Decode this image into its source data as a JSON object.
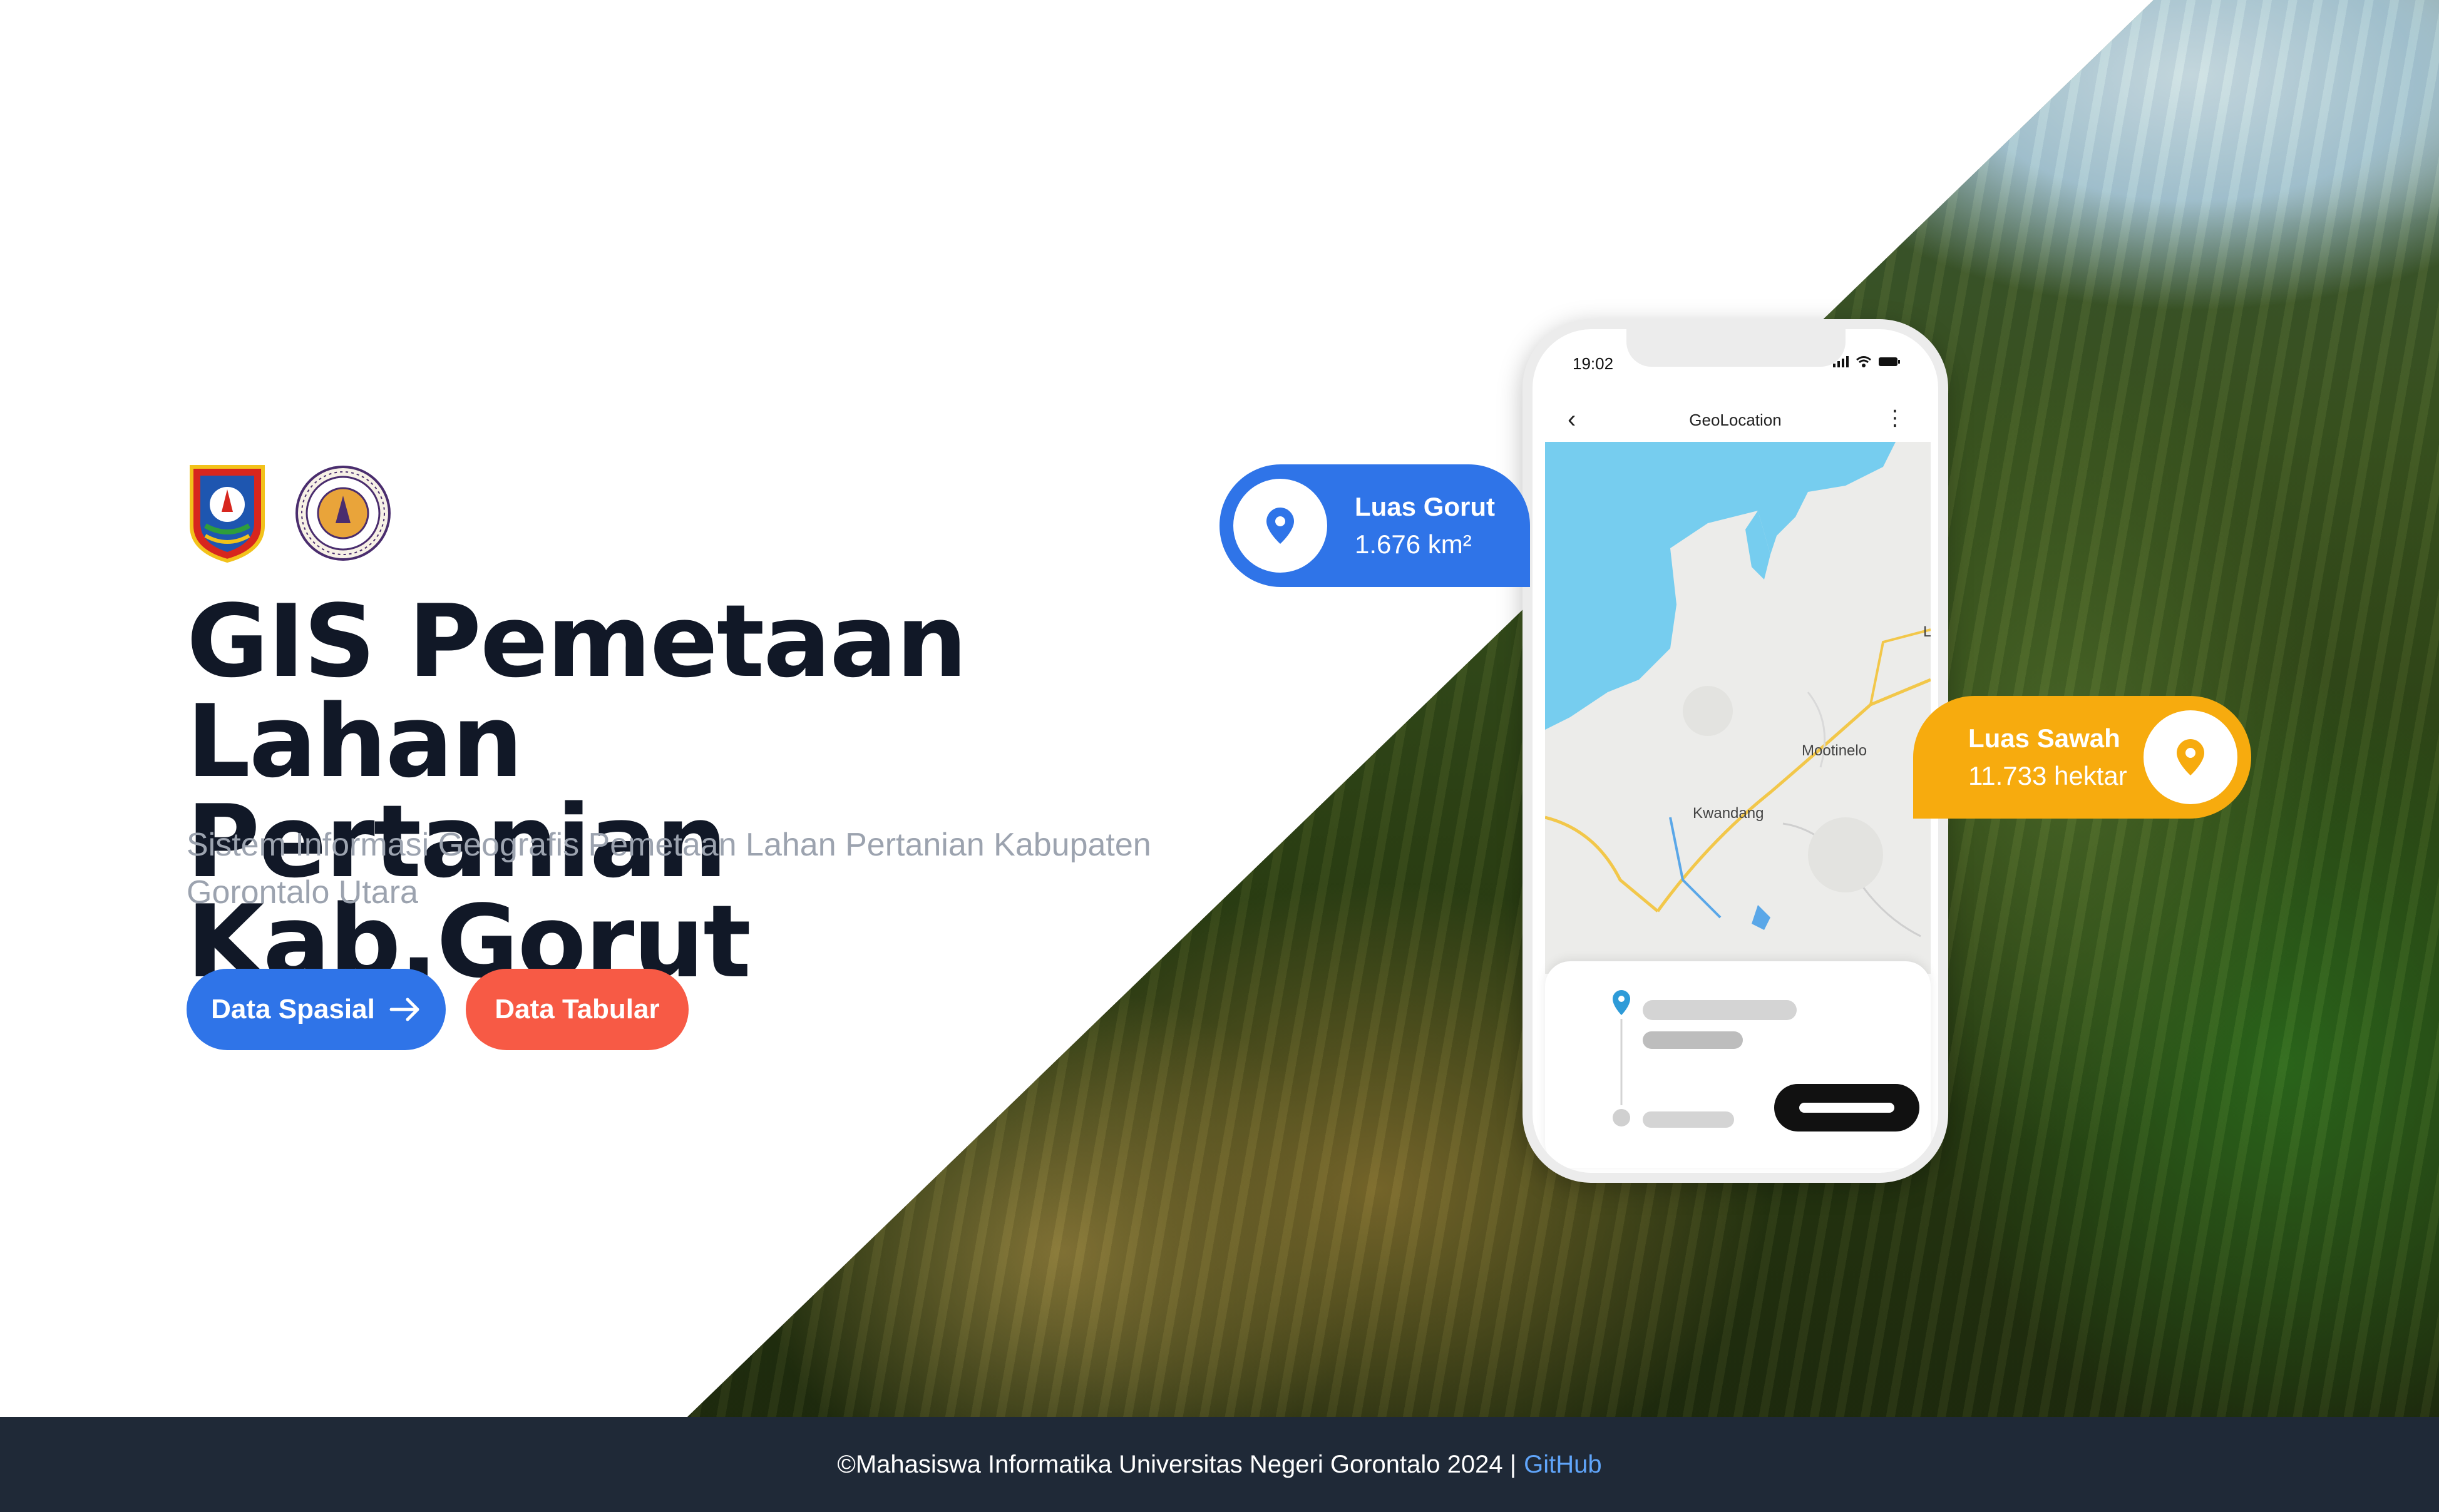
{
  "hero": {
    "title_line1": "GIS Pemetaan Lahan",
    "title_line2": "Pertanian Kab.Gorut",
    "subtitle": "Sistem Informasi Geografis Pemetaan Lahan Pertanian Kabupaten Gorontalo Utara",
    "logos": [
      "gorontalo-utara-regency-logo",
      "universitas-negeri-gorontalo-logo"
    ],
    "buttons": {
      "spasial_label": "Data Spasial",
      "spasial_icon": "arrow-right-icon",
      "tabular_label": "Data Tabular"
    }
  },
  "phone": {
    "status_time": "19:02",
    "app_title": "GeoLocation",
    "map_labels": {
      "town1": "Mootinelo",
      "town2": "Kwandang",
      "edge": "L"
    }
  },
  "callouts": {
    "gorut": {
      "label": "Luas Gorut",
      "value": "1.676 km²",
      "icon": "map-pin-icon"
    },
    "sawah": {
      "label": "Luas Sawah",
      "value": "11.733 hektar",
      "icon": "map-pin-icon"
    }
  },
  "footer": {
    "text": "©Mahasiswa Informatika Universitas Negeri Gorontalo 2024 |",
    "link": "GitHub"
  },
  "colors": {
    "primary": "#2f74e8",
    "danger": "#f75a45",
    "warning": "#f7ab0e",
    "footer_bg": "#1f2937",
    "title": "#111827",
    "subtitle": "#9ca3af"
  }
}
